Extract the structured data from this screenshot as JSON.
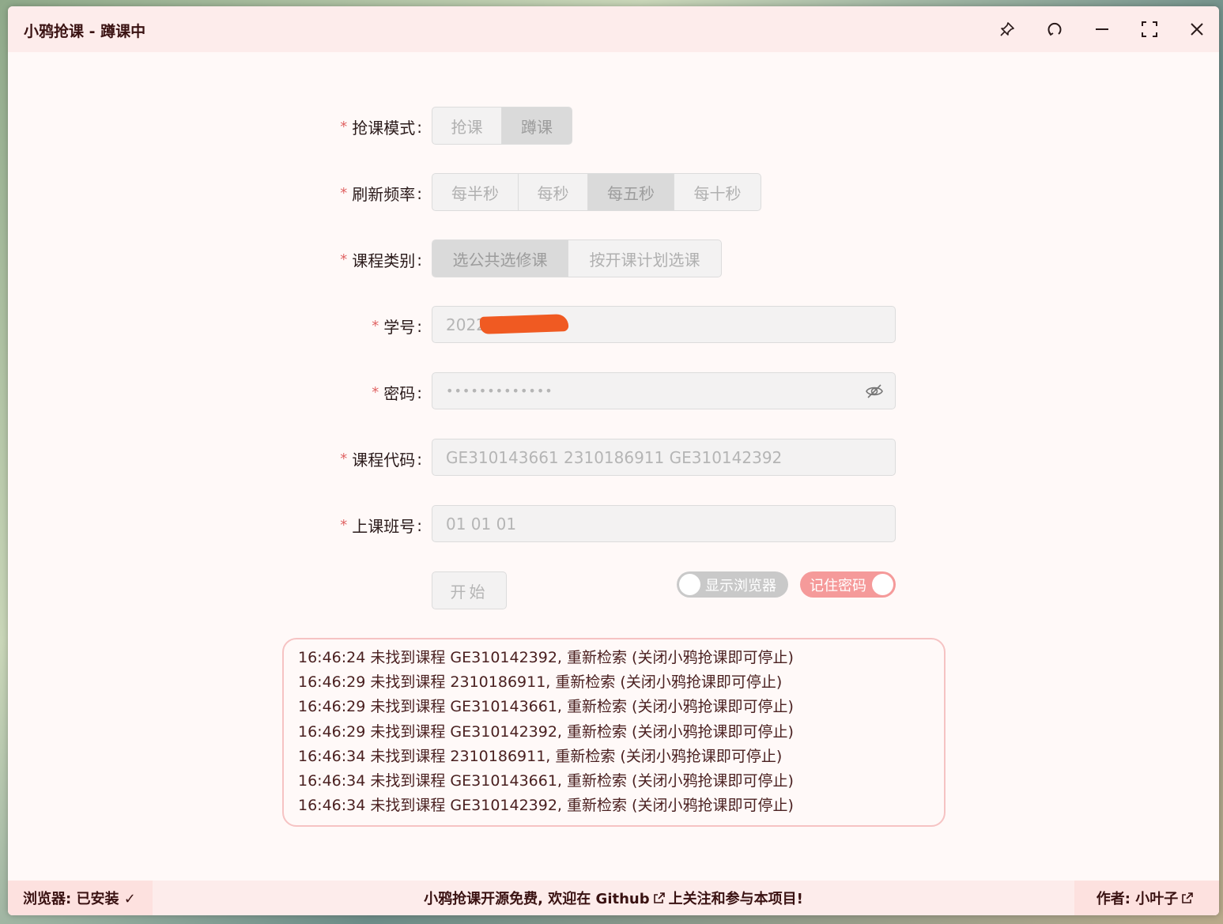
{
  "window": {
    "title": "小鸦抢课 - 蹲课中"
  },
  "form": {
    "mode": {
      "label": "抢课模式",
      "options": [
        "抢课",
        "蹲课"
      ],
      "selected": "蹲课"
    },
    "refresh": {
      "label": "刷新频率",
      "options": [
        "每半秒",
        "每秒",
        "每五秒",
        "每十秒"
      ],
      "selected": "每五秒"
    },
    "category": {
      "label": "课程类别",
      "options": [
        "选公共选修课",
        "按开课计划选课"
      ],
      "selected": "选公共选修课"
    },
    "student_id": {
      "label": "学号",
      "value": "2022"
    },
    "password": {
      "label": "密码",
      "value": "•••••••••••••"
    },
    "course_codes": {
      "label": "课程代码",
      "value": "GE310143661 2310186911 GE310142392"
    },
    "class_numbers": {
      "label": "上课班号",
      "value": "01 01 01"
    },
    "colon": ":",
    "required_mark": "*"
  },
  "actions": {
    "start_label": "开始",
    "show_browser": {
      "label": "显示浏览器",
      "on": false
    },
    "remember_password": {
      "label": "记住密码",
      "on": true
    }
  },
  "log": [
    "16:46:24  未找到课程 GE310142392, 重新检索 (关闭小鸦抢课即可停止)",
    "16:46:29  未找到课程 2310186911, 重新检索 (关闭小鸦抢课即可停止)",
    "16:46:29  未找到课程 GE310143661, 重新检索 (关闭小鸦抢课即可停止)",
    "16:46:29  未找到课程 GE310142392, 重新检索 (关闭小鸦抢课即可停止)",
    "16:46:34  未找到课程 2310186911, 重新检索 (关闭小鸦抢课即可停止)",
    "16:46:34  未找到课程 GE310143661, 重新检索 (关闭小鸦抢课即可停止)",
    "16:46:34  未找到课程 GE310142392, 重新检索 (关闭小鸦抢课即可停止)"
  ],
  "footer": {
    "browser_status": "浏览器: 已安装 ✓",
    "promo_before": "小鸦抢课开源免费, 欢迎在 Github",
    "promo_after": "上关注和参与本项目!",
    "author": "作者: 小叶子"
  },
  "colors": {
    "accent": "#f59a9a",
    "titlebar_bg": "#fdeceb",
    "log_border": "#f6c3c3",
    "required": "#e06464"
  }
}
